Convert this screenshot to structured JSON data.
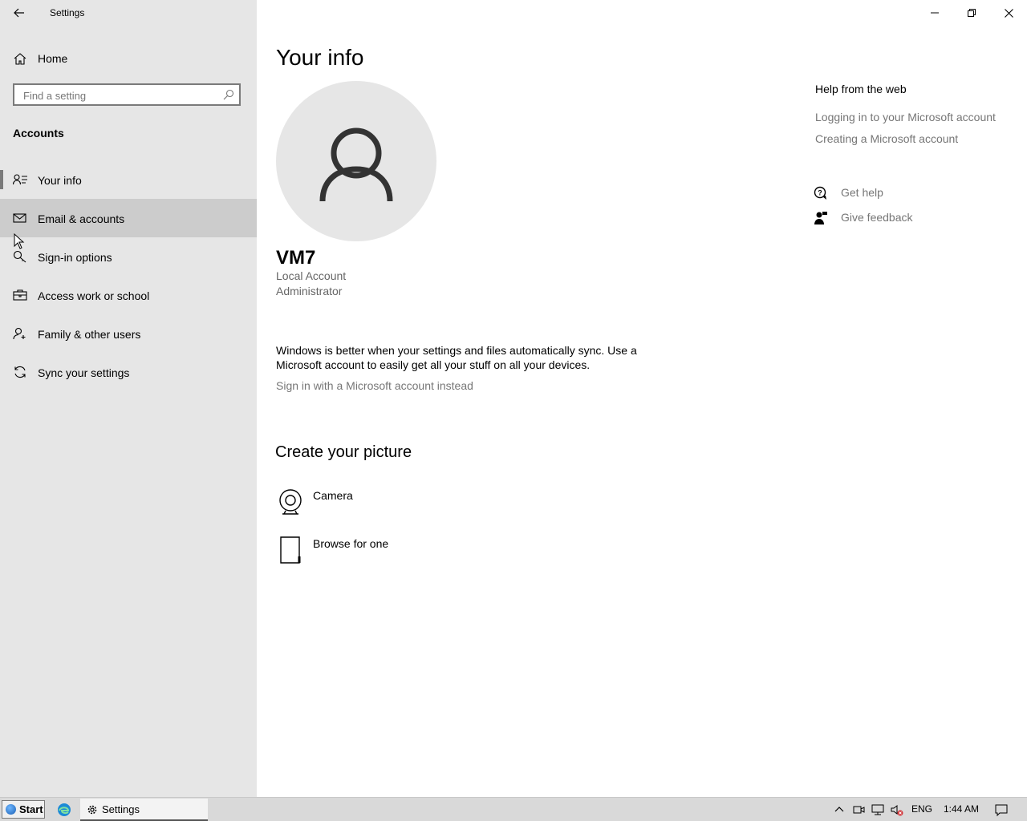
{
  "window": {
    "app_title": "Settings",
    "back_icon": "back-arrow-icon",
    "controls": [
      "minimize-icon",
      "restore-icon",
      "close-icon"
    ]
  },
  "sidebar": {
    "home_label": "Home",
    "search_placeholder": "Find a setting",
    "section": "Accounts",
    "items": [
      {
        "label": "Your info",
        "icon": "person-card-icon",
        "selected": true
      },
      {
        "label": "Email & accounts",
        "icon": "mail-icon",
        "hovered": true
      },
      {
        "label": "Sign-in options",
        "icon": "key-icon"
      },
      {
        "label": "Access work or school",
        "icon": "briefcase-icon"
      },
      {
        "label": "Family & other users",
        "icon": "person-add-icon"
      },
      {
        "label": "Sync your settings",
        "icon": "sync-icon"
      }
    ]
  },
  "main": {
    "title": "Your info",
    "user": {
      "name": "VM7",
      "account_type": "Local Account",
      "role": "Administrator"
    },
    "sync_text": "Windows is better when your settings and files automatically sync. Use a Microsoft account to easily get all your stuff on all your devices.",
    "sign_in_link": "Sign in with a Microsoft account instead",
    "create_picture_title": "Create your picture",
    "picture_options": [
      {
        "label": "Camera",
        "icon": "camera-icon"
      },
      {
        "label": "Browse for one",
        "icon": "document-icon"
      }
    ]
  },
  "help": {
    "title": "Help from the web",
    "links": [
      "Logging in to your Microsoft account",
      "Creating a Microsoft account"
    ],
    "get_help": "Get help",
    "give_feedback": "Give feedback"
  },
  "taskbar": {
    "start_label": "Start",
    "task_label": "Settings",
    "language": "ENG",
    "time": "1:44 AM"
  },
  "colors": {
    "sidebar_bg": "#e6e6e6",
    "hover_bg": "#cccccc",
    "link_gray": "#767676",
    "taskbar_bg": "#d9d9d9"
  }
}
